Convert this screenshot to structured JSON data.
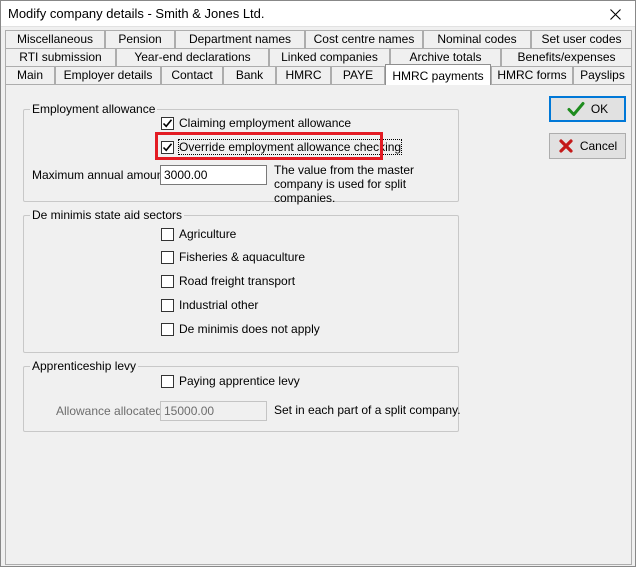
{
  "window": {
    "title": "Modify company details - Smith & Jones Ltd."
  },
  "tabs": {
    "row1": [
      "Miscellaneous",
      "Pension",
      "Department names",
      "Cost centre names",
      "Nominal codes",
      "Set user codes"
    ],
    "row2": [
      "RTI submission",
      "Year-end declarations",
      "Linked companies",
      "Archive totals",
      "Benefits/expenses"
    ],
    "row3": [
      "Main",
      "Employer details",
      "Contact",
      "Bank",
      "HMRC",
      "PAYE",
      "HMRC payments",
      "HMRC forms",
      "Payslips"
    ],
    "active": "HMRC payments"
  },
  "employment_allowance": {
    "group_label": "Employment allowance",
    "claiming_label": "Claiming employment allowance",
    "claiming_checked": true,
    "override_label": "Override employment allowance checking",
    "override_checked": true,
    "max_amount_label": "Maximum annual amount:",
    "max_amount_value": "3000.00",
    "max_amount_note": "The value from the master company is used for split companies."
  },
  "de_minimis": {
    "group_label": "De minimis state aid sectors",
    "items": [
      {
        "label": "Agriculture",
        "checked": false
      },
      {
        "label": "Fisheries & aquaculture",
        "checked": false
      },
      {
        "label": "Road freight transport",
        "checked": false
      },
      {
        "label": "Industrial other",
        "checked": false
      },
      {
        "label": "De minimis does not apply",
        "checked": false
      }
    ]
  },
  "apprenticeship_levy": {
    "group_label": "Apprenticeship levy",
    "paying_label": "Paying apprentice levy",
    "paying_checked": false,
    "allowance_label": "Allowance allocated:",
    "allowance_value": "15000.00",
    "allowance_note": "Set in each part of a split company."
  },
  "buttons": {
    "ok_label": "OK",
    "cancel_label": "Cancel"
  },
  "colors": {
    "highlight": "#e31b23",
    "ok_check": "#1e8c1e",
    "cancel_x": "#c41a1a",
    "focus": "#0078d7"
  }
}
